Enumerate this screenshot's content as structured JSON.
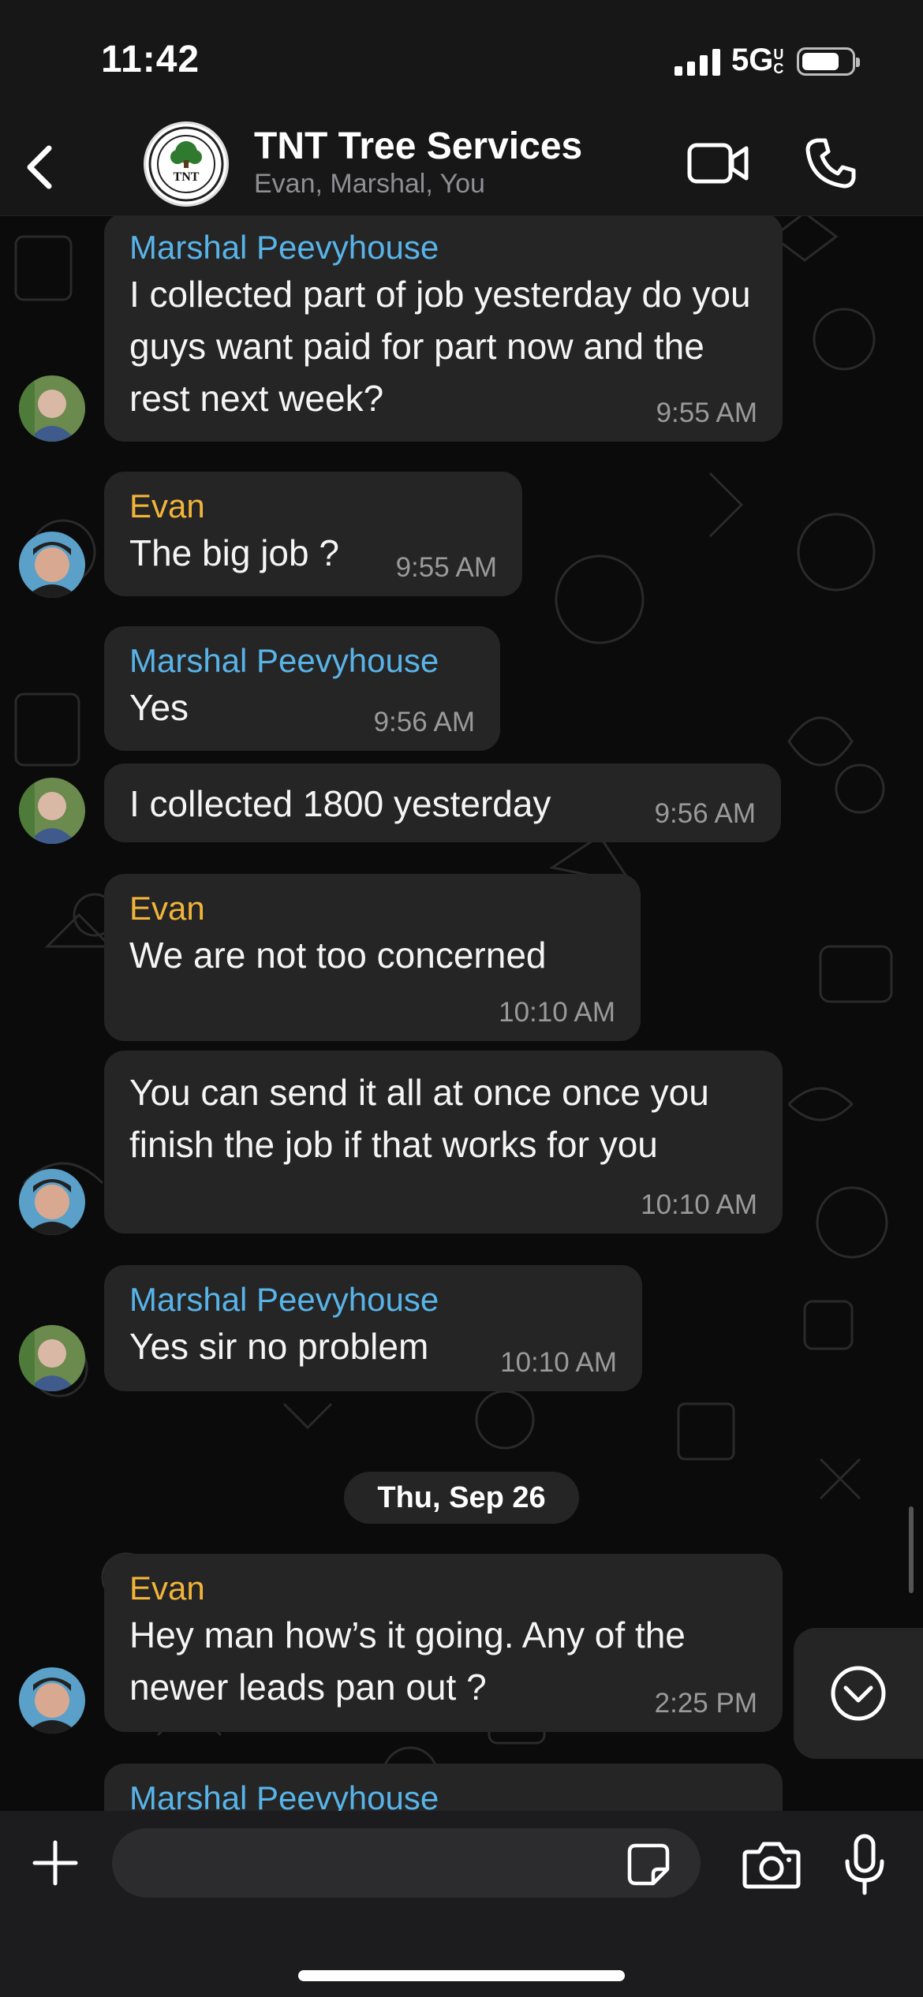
{
  "status_bar": {
    "time": "11:42",
    "network": "5G",
    "network_sub": "UC"
  },
  "header": {
    "title": "TNT Tree Services",
    "subtitle": "Evan, Marshal, You",
    "logo_text": "TNT"
  },
  "messages": [
    {
      "sender": "Marshal Peevyhouse",
      "text": "I collected part of job yesterday do you guys want paid for part now and the rest next week?",
      "time": "9:55 AM"
    },
    {
      "sender": "Evan",
      "text": "The big job ?",
      "time": "9:55 AM"
    },
    {
      "sender": "Marshal Peevyhouse",
      "text": "Yes",
      "time": "9:56 AM"
    },
    {
      "sender": "",
      "text": "I collected 1800 yesterday",
      "time": "9:56 AM"
    },
    {
      "sender": "Evan",
      "text": "We are not too concerned",
      "time": "10:10 AM"
    },
    {
      "sender": "",
      "text": "You can send it all at once once you finish the job if that works for you",
      "time": "10:10 AM"
    },
    {
      "sender": "Marshal Peevyhouse",
      "text": "Yes sir no problem",
      "time": "10:10 AM"
    },
    {
      "sender": "Evan",
      "text": "Hey man how’s it going. Any of the newer leads pan out ?",
      "time": "2:25 PM"
    },
    {
      "sender": "Marshal Peevyhouse",
      "text": "",
      "time": ""
    }
  ],
  "date_divider": "Thu, Sep 26",
  "icons": {
    "back": "chevron-left-icon",
    "video": "video-camera-icon",
    "call": "phone-icon",
    "scroll_down": "chevron-down-circle-icon",
    "attach": "plus-icon",
    "sticker": "sticker-icon",
    "camera": "camera-icon",
    "mic": "microphone-icon"
  },
  "colors": {
    "marshal": "#58b4e8",
    "evan": "#f2b53a",
    "bubble": "#252526",
    "background": "#0b0b0b"
  }
}
